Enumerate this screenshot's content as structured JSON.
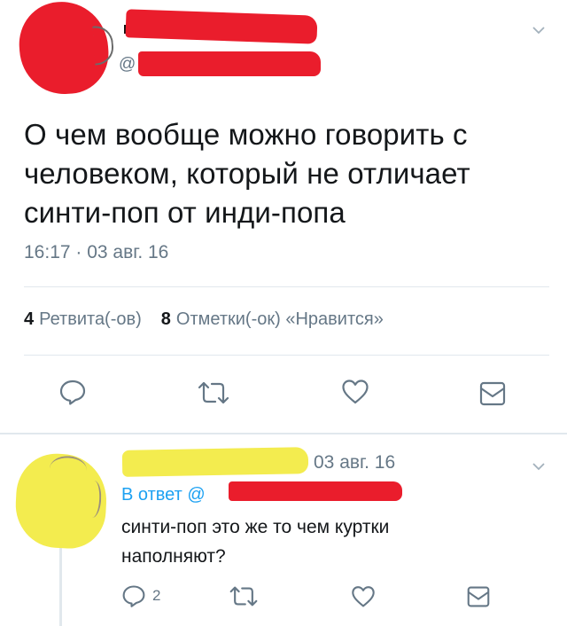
{
  "main_tweet": {
    "handle_prefix": "@",
    "text": "О чем вообще можно говорить с\nчеловеком, который не отличает\nсинти-поп от инди-попа",
    "time": "16:17 · 03 авг. 16",
    "retweets": {
      "count": "4",
      "label": "Ретвита(-ов)"
    },
    "likes": {
      "count": "8",
      "label": "Отметки(-ок) «Нравится»"
    }
  },
  "reply": {
    "date": "03 авг. 16",
    "reply_to": "В ответ @",
    "text": "синти-поп это же то чем куртки\nнаполняют?",
    "reply_count": "2"
  },
  "icons": {
    "reply": "reply-icon",
    "retweet": "retweet-icon",
    "like": "heart-icon",
    "dm": "message-icon",
    "menu": "chevron-down-icon"
  },
  "colors": {
    "accent": "#1da1f2",
    "icon": "#657786",
    "redaction_red": "#ea1d2c",
    "redaction_yellow": "#f3ec4f"
  }
}
